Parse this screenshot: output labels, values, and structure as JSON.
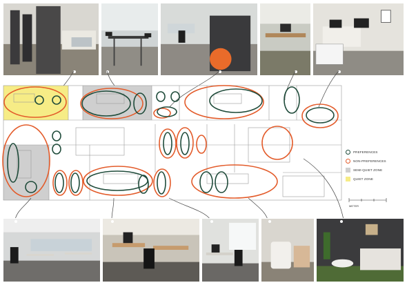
{
  "legend": {
    "items": [
      {
        "key": "preferences",
        "label": "PREFERENCES",
        "color": "#1f4b3a"
      },
      {
        "key": "non_preferences",
        "label": "NON-PREFERENCES",
        "color": "#e35b2a"
      },
      {
        "key": "semi_quiet",
        "label": "SEMI-QUIET ZONE",
        "color": "#cfcfcf"
      },
      {
        "key": "quiet",
        "label": "QUIET ZONE",
        "color": "#f6ec86"
      }
    ]
  },
  "scale": {
    "label": "METER"
  },
  "photos": {
    "top": [
      "office-partitions-photo",
      "high-table-stools-photo",
      "orange-ball-chair-photo",
      "corridor-desk-photo",
      "workstation-corner-photo"
    ],
    "bottom": [
      "open-office-desks-photo",
      "sit-stand-desks-photo",
      "window-desk-photo",
      "lounge-chair-photo",
      "sofa-lounge-photo"
    ]
  },
  "colors": {
    "preference": "#1f4b3a",
    "non_preference": "#e35b2a",
    "semi_quiet": "#cfcfcf",
    "quiet": "#f6ec86"
  }
}
